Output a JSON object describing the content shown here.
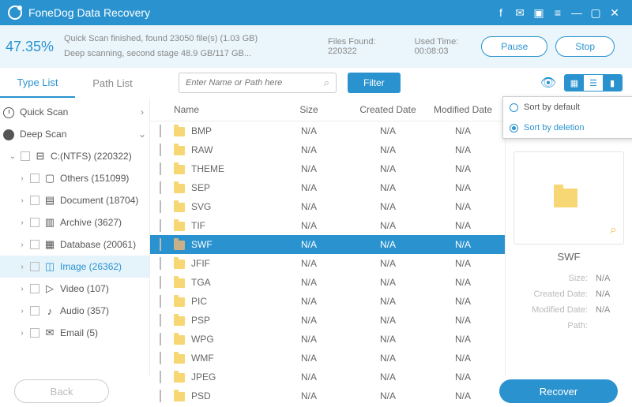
{
  "titlebar": {
    "title": "FoneDog Data Recovery"
  },
  "scan": {
    "percent": "47.35%",
    "line1": "Quick Scan finished, found 23050 file(s) (1.03 GB)",
    "line2": "Deep scanning, second stage 48.9 GB/117 GB...",
    "files_label": "Files Found: ",
    "files": "220322",
    "time_label": "Used Time: ",
    "time": "00:08:03",
    "pause": "Pause",
    "stop": "Stop"
  },
  "tabs": {
    "type": "Type List",
    "path": "Path List"
  },
  "search": {
    "ph": "Enter Name or Path here",
    "filter": "Filter"
  },
  "sort": {
    "a": "Sort by default",
    "b": "Sort by deletion"
  },
  "cols": {
    "name": "Name",
    "size": "Size",
    "created": "Created Date",
    "modified": "Modified Date"
  },
  "tree": {
    "quick": "Quick Scan",
    "deep": "Deep Scan",
    "drive": "C:(NTFS) (220322)",
    "items": [
      {
        "label": "Others (151099)",
        "icon": "▢"
      },
      {
        "label": "Document (18704)",
        "icon": "▤"
      },
      {
        "label": "Archive (3627)",
        "icon": "▥"
      },
      {
        "label": "Database (20061)",
        "icon": "▦"
      },
      {
        "label": "Image (26362)",
        "icon": "◫",
        "sel": true
      },
      {
        "label": "Video (107)",
        "icon": "▷"
      },
      {
        "label": "Audio (357)",
        "icon": "♪"
      },
      {
        "label": "Email (5)",
        "icon": "✉"
      }
    ]
  },
  "files": [
    {
      "n": "BMP",
      "s": "N/A",
      "c": "N/A",
      "m": "N/A"
    },
    {
      "n": "RAW",
      "s": "N/A",
      "c": "N/A",
      "m": "N/A"
    },
    {
      "n": "THEME",
      "s": "N/A",
      "c": "N/A",
      "m": "N/A"
    },
    {
      "n": "SEP",
      "s": "N/A",
      "c": "N/A",
      "m": "N/A"
    },
    {
      "n": "SVG",
      "s": "N/A",
      "c": "N/A",
      "m": "N/A"
    },
    {
      "n": "TIF",
      "s": "N/A",
      "c": "N/A",
      "m": "N/A"
    },
    {
      "n": "SWF",
      "s": "N/A",
      "c": "N/A",
      "m": "N/A",
      "sel": true
    },
    {
      "n": "JFIF",
      "s": "N/A",
      "c": "N/A",
      "m": "N/A"
    },
    {
      "n": "TGA",
      "s": "N/A",
      "c": "N/A",
      "m": "N/A"
    },
    {
      "n": "PIC",
      "s": "N/A",
      "c": "N/A",
      "m": "N/A"
    },
    {
      "n": "PSP",
      "s": "N/A",
      "c": "N/A",
      "m": "N/A"
    },
    {
      "n": "WPG",
      "s": "N/A",
      "c": "N/A",
      "m": "N/A"
    },
    {
      "n": "WMF",
      "s": "N/A",
      "c": "N/A",
      "m": "N/A"
    },
    {
      "n": "JPEG",
      "s": "N/A",
      "c": "N/A",
      "m": "N/A"
    },
    {
      "n": "PSD",
      "s": "N/A",
      "c": "N/A",
      "m": "N/A"
    }
  ],
  "preview": {
    "name": "SWF",
    "size_k": "Size:",
    "size_v": "N/A",
    "created_k": "Created Date:",
    "created_v": "N/A",
    "modified_k": "Modified Date:",
    "modified_v": "N/A",
    "path_k": "Path:"
  },
  "footer": {
    "back": "Back",
    "recover": "Recover"
  }
}
